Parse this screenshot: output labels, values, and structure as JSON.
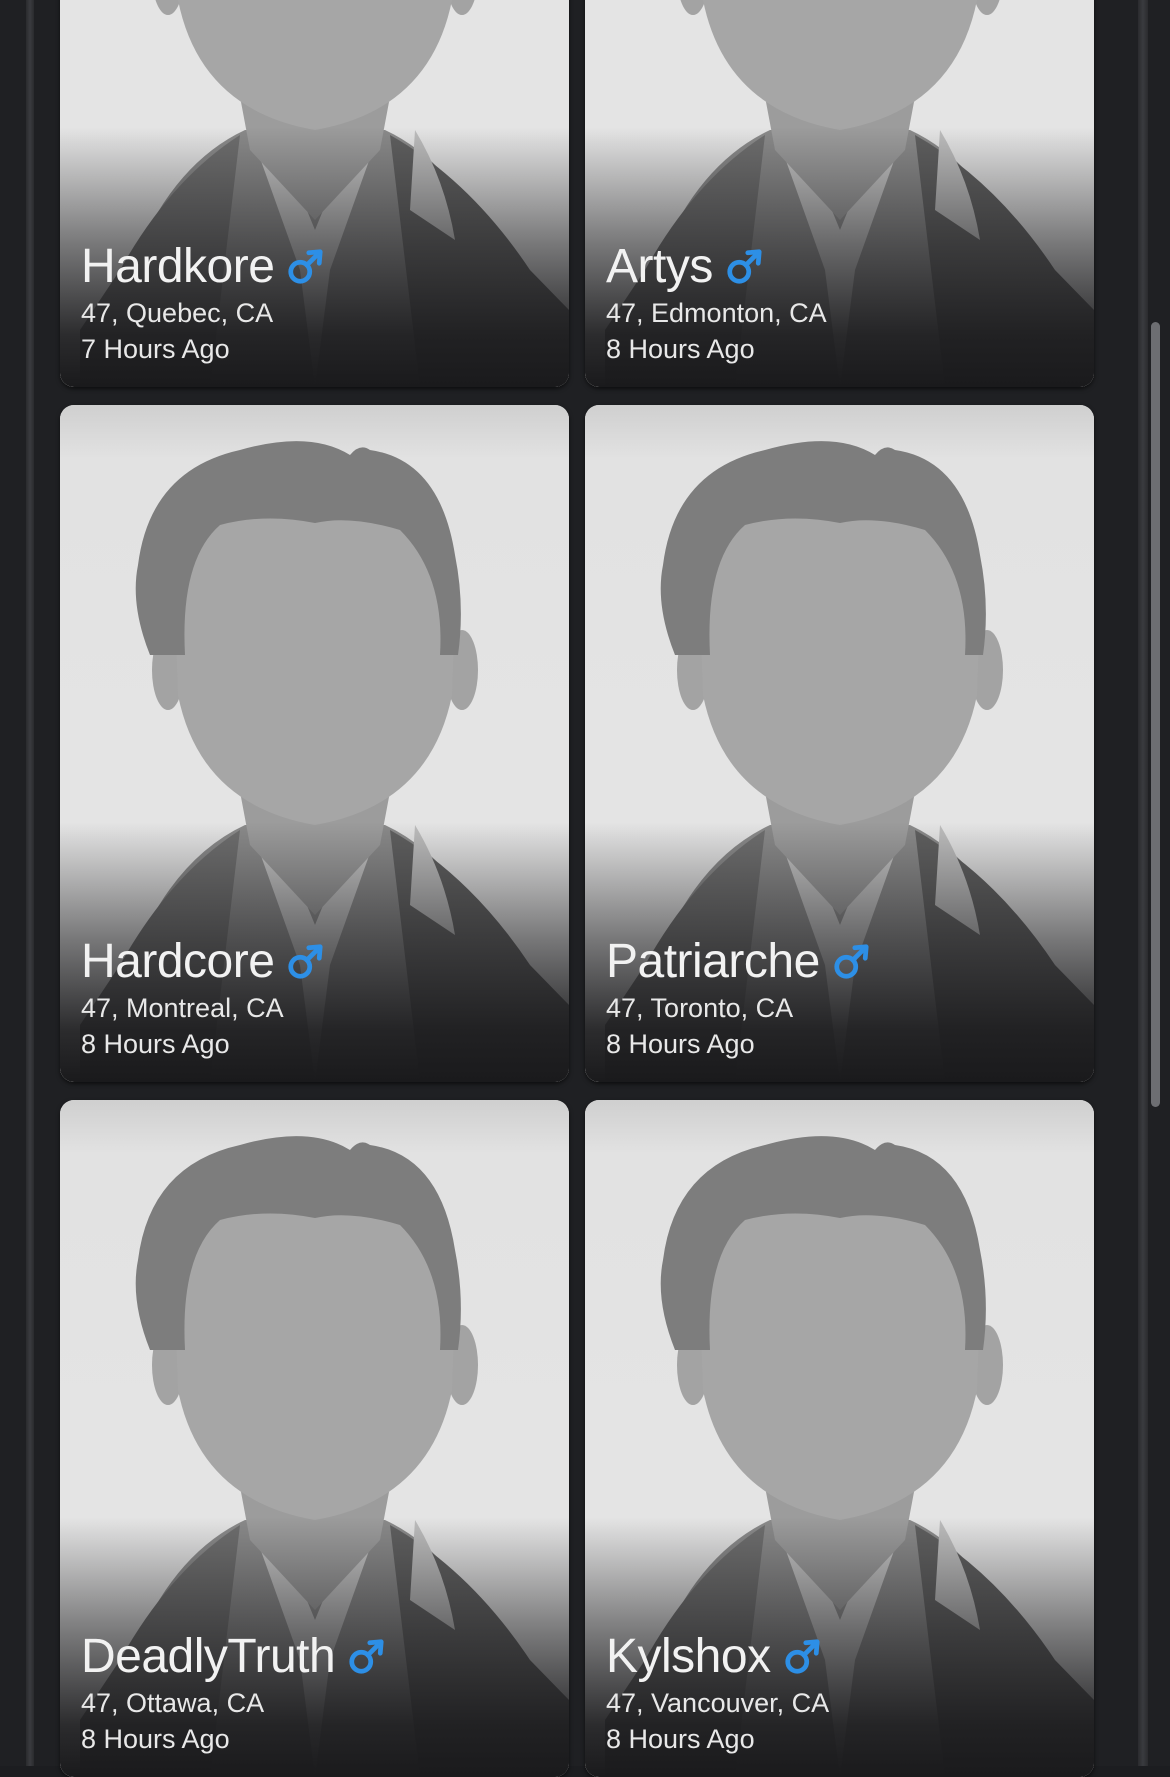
{
  "colors": {
    "background": "#1f2023",
    "accent_male": "#2d8fe6",
    "card_text": "#ffffff"
  },
  "profiles": [
    {
      "name": "Hardkore",
      "gender_icon": "male-icon",
      "location": "47, Quebec, CA",
      "last_seen": "7 Hours Ago"
    },
    {
      "name": "Artys",
      "gender_icon": "male-icon",
      "location": "47, Edmonton, CA",
      "last_seen": "8 Hours Ago"
    },
    {
      "name": "Hardcore",
      "gender_icon": "male-icon",
      "location": "47, Montreal, CA",
      "last_seen": "8 Hours Ago"
    },
    {
      "name": "Patriarche",
      "gender_icon": "male-icon",
      "location": "47, Toronto, CA",
      "last_seen": "8 Hours Ago"
    },
    {
      "name": "DeadlyTruth",
      "gender_icon": "male-icon",
      "location": "47, Ottawa, CA",
      "last_seen": "8 Hours Ago"
    },
    {
      "name": "Kylshox",
      "gender_icon": "male-icon",
      "location": "47, Vancouver, CA",
      "last_seen": "8 Hours Ago"
    }
  ]
}
